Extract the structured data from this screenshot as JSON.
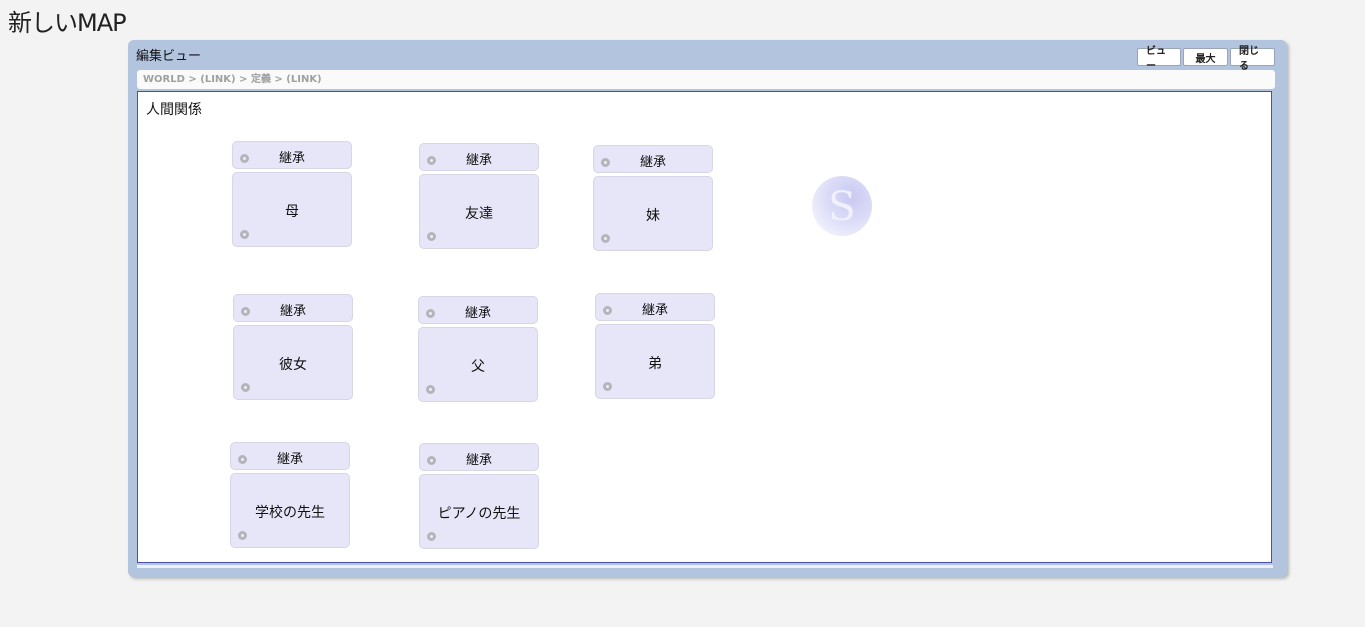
{
  "app_title": "新しいMAP",
  "window": {
    "title": "編集ビュー",
    "buttons": {
      "view": "ビュー",
      "maximize": "最大",
      "close": "閉じる"
    },
    "breadcrumb": "WORLD > (LINK) > 定義 > (LINK)"
  },
  "canvas": {
    "title": "人間関係",
    "nodes": [
      {
        "head": "継承",
        "body": "母"
      },
      {
        "head": "継承",
        "body": "友達"
      },
      {
        "head": "継承",
        "body": "妹"
      },
      {
        "head": "継承",
        "body": "彼女"
      },
      {
        "head": "継承",
        "body": "父"
      },
      {
        "head": "継承",
        "body": "弟"
      },
      {
        "head": "継承",
        "body": "学校の先生"
      },
      {
        "head": "継承",
        "body": "ピアノの先生"
      }
    ]
  },
  "colors": {
    "window_frame": "#b3c4de",
    "node_fill": "#e6e6f8",
    "canvas_border": "#4a4fa8"
  },
  "icons": {
    "node_handle": "circle-handle-icon",
    "logo": "s-logo-icon"
  }
}
